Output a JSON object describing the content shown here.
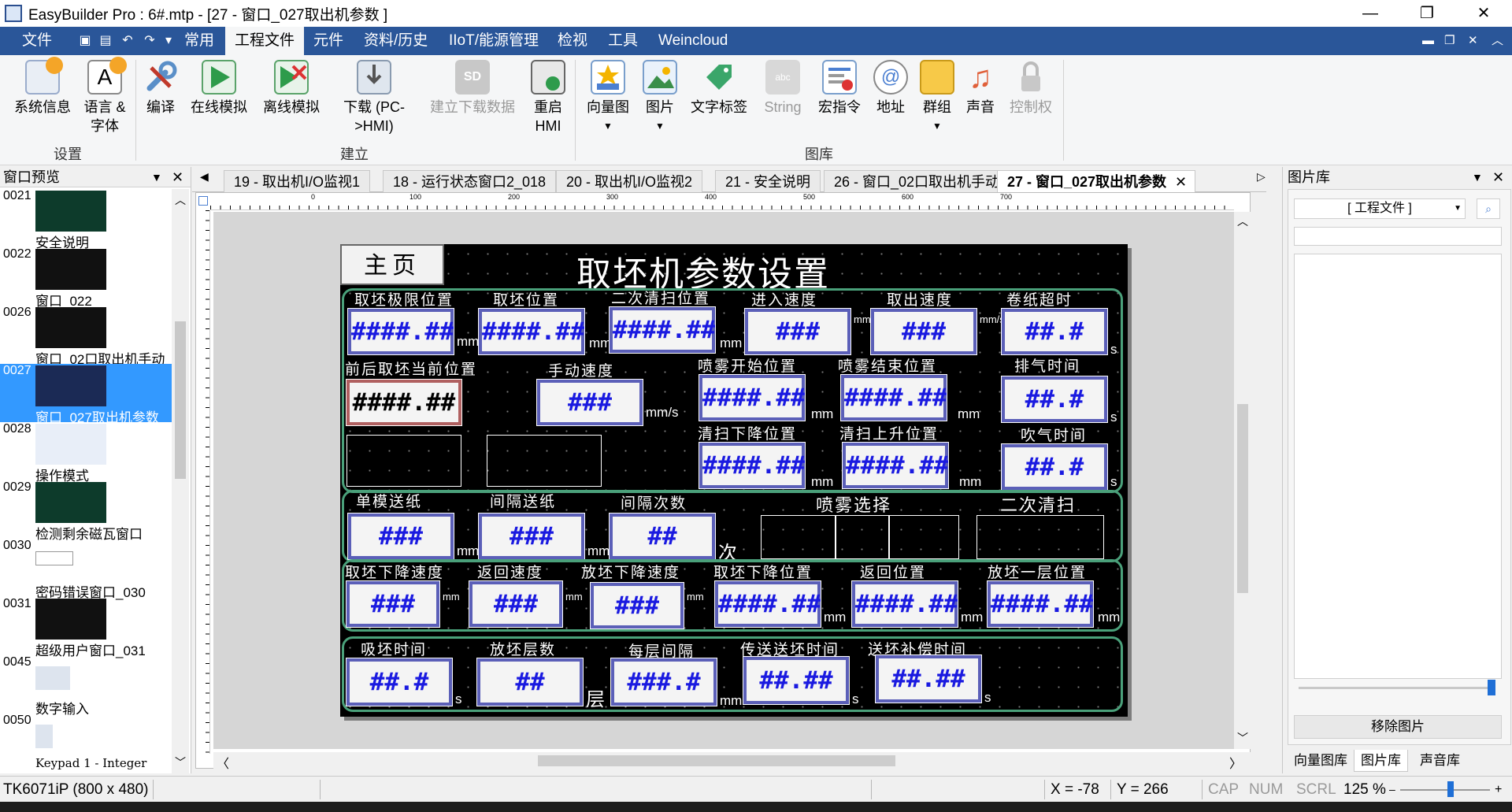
{
  "window": {
    "title": "EasyBuilder Pro : 6#.mtp - [27 - 窗口_027取出机参数 ]",
    "minimize": "—",
    "restore": "❐",
    "close": "✕"
  },
  "menu": {
    "file": "文件",
    "common": "常用",
    "project": "工程文件",
    "objects": "元件",
    "data_history": "资料/历史",
    "iiot": "IIoT/能源管理",
    "view": "检视",
    "tools": "工具",
    "weincloud": "Weincloud"
  },
  "ribbon": {
    "groups": {
      "settings": "设置",
      "build": "建立",
      "library": "图库"
    },
    "buttons": {
      "sysinfo": "系统信息",
      "language": "语言 &",
      "language2": "字体",
      "compile": "编译",
      "online_sim": "在线模拟",
      "offline_sim": "离线模拟",
      "download": "下载 (PC-",
      "download2": ">HMI)",
      "build_download": "建立下载数据",
      "reboot": "重启",
      "reboot2": "HMI",
      "vector": "向量图",
      "picture": "图片",
      "text_tag": "文字标签",
      "string": "String",
      "macro": "宏指令",
      "address": "地址",
      "group": "群组",
      "sound": "声音",
      "control": "控制权"
    }
  },
  "left_panel": {
    "title": "窗口预览",
    "items": [
      {
        "num": "0021",
        "label": "安全说明"
      },
      {
        "num": "0022",
        "label": "窗口_022"
      },
      {
        "num": "0026",
        "label": "窗口_02口取出机手动"
      },
      {
        "num": "0027",
        "label": "窗口_027取出机参数"
      },
      {
        "num": "0028",
        "label": "操作模式"
      },
      {
        "num": "0029",
        "label": "检测剩余磁瓦窗口"
      },
      {
        "num": "0030",
        "label": "密码错误窗口_030"
      },
      {
        "num": "0031",
        "label": "超级用户窗口_031"
      },
      {
        "num": "0045",
        "label": "数字输入"
      },
      {
        "num": "0050",
        "label": "Keypad 1 - Integer"
      }
    ]
  },
  "tabs": [
    "19 - 取出机I/O监视1",
    "18 - 运行状态窗口2_018",
    "20 - 取出机I/O监视2",
    "21 - 安全说明",
    "26 - 窗口_02口取出机手动",
    "27 - 窗口_027取出机参数"
  ],
  "ruler": {
    "labels": [
      "0",
      "100",
      "200",
      "300",
      "400",
      "500",
      "600",
      "700"
    ]
  },
  "hmi": {
    "home": "主页",
    "title": "取坯机参数设置",
    "row1": {
      "labels": [
        "取坯极限位置",
        "取坯位置",
        "二次清扫位置",
        "进入速度",
        "取出速度",
        "卷纸超时"
      ],
      "values": [
        "####.##",
        "####.##",
        "####.##",
        "###",
        "###",
        "##.#"
      ],
      "units": [
        "mm",
        "mm",
        "mm",
        "mm/s",
        "mm/s",
        "s"
      ]
    },
    "row2": {
      "labels": [
        "前后取坯当前位置",
        "手动速度",
        "喷雾开始位置",
        "喷雾结束位置",
        "排气时间"
      ],
      "values": [
        "####.##",
        "###",
        "####.##",
        "####.##",
        "##.#"
      ],
      "units": [
        "mm/s",
        "mm",
        "mm",
        "s"
      ]
    },
    "row3": {
      "labels": [
        "清扫下降位置",
        "清扫上升位置",
        "吹气时间"
      ],
      "values": [
        "####.##",
        "####.##",
        "##.#"
      ],
      "units": [
        "mm",
        "mm",
        "s"
      ]
    },
    "row4": {
      "labels": [
        "单模送纸",
        "间隔送纸",
        "间隔次数",
        "喷雾选择",
        "二次清扫"
      ],
      "values": [
        "###",
        "###",
        "##"
      ],
      "units": [
        "mm",
        "mm",
        "次"
      ]
    },
    "row5": {
      "labels": [
        "取坯下降速度",
        "返回速度",
        "放坯下降速度",
        "取坯下降位置",
        "返回位置",
        "放坯一层位置"
      ],
      "values": [
        "###",
        "###",
        "###",
        "####.##",
        "####.##",
        "####.##"
      ],
      "units": [
        "mm",
        "mm",
        "mm",
        "mm",
        "mm",
        "mm"
      ]
    },
    "row6": {
      "labels": [
        "吸坯时间",
        "放坯层数",
        "每层间隔",
        "传送送坯时间",
        "送坯补偿时间"
      ],
      "values": [
        "##.#",
        "##",
        "###.#",
        "##.##",
        "##.##"
      ],
      "units": [
        "s",
        "层",
        "mm",
        "s",
        "s"
      ]
    }
  },
  "right_panel": {
    "title": "图片库",
    "dropdown": "[ 工程文件 ]",
    "remove_button": "移除图片",
    "bottom_tabs": [
      "向量图库",
      "图片库",
      "声音库"
    ]
  },
  "status": {
    "device": "TK6071iP (800 x 480)",
    "x": "X = -78",
    "y": "Y = 266",
    "cap": "CAP",
    "num": "NUM",
    "scrl": "SCRL",
    "zoom": "125 %"
  }
}
